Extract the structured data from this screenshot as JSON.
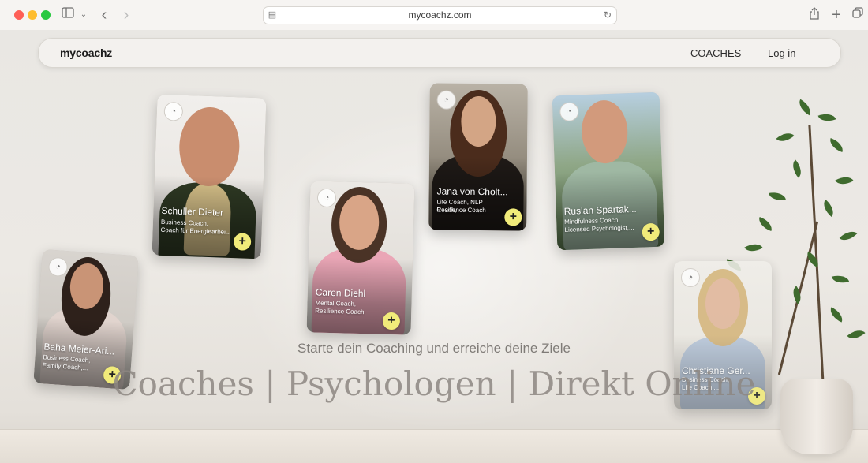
{
  "browser": {
    "url": "mycoachz.com"
  },
  "site": {
    "logo": "mycoachz",
    "nav": {
      "coaches": "COACHES",
      "login": "Log in"
    }
  },
  "hero": {
    "subtitle": "Starte dein Coaching und erreiche deine Ziele",
    "headline": "Coaches | Psychologen | Direkt Online"
  },
  "coaches": [
    {
      "name": "Schuller Dieter",
      "roles": [
        "Business Coach,",
        "Coach für Energiearbei..."
      ]
    },
    {
      "name": "Caren Diehl",
      "roles": [
        "Mental Coach,",
        "Resilience Coach"
      ]
    },
    {
      "name": "Jana von Cholt...",
      "roles": [
        "Life Coach, NLP Coach,",
        "Resilience Coach"
      ]
    },
    {
      "name": "Ruslan Spartak...",
      "roles": [
        "Mindfulness Coach,",
        "Licensed Psychologist,..."
      ]
    },
    {
      "name": "Baha Meier-Ari...",
      "roles": [
        "Business Coach,",
        "Family Coach,..."
      ]
    },
    {
      "name": "Christiane Ger...",
      "roles": [
        "Business Coach,",
        "Life Coach,..."
      ]
    }
  ],
  "icons": {
    "add": "+",
    "badge": "mycoachz-logo-icon"
  },
  "colors": {
    "add_button": "#f1eb7a"
  }
}
